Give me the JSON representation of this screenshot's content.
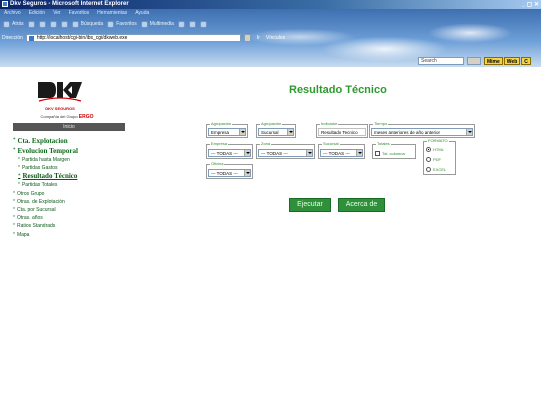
{
  "window": {
    "title": "Dkv Seguros - Microsoft Internet Explorer",
    "controls": "_ ▢ ✕"
  },
  "menu": [
    "Archivo",
    "Edición",
    "Ver",
    "Favoritos",
    "Herramientas",
    "Ayuda"
  ],
  "toolbar": {
    "back": "Atrás",
    "search": "Búsqueda",
    "favorites": "Favoritos",
    "media": "Multimedia"
  },
  "address": {
    "label": "Dirección",
    "url": "http://localhost/cgi-bin/ibs_cgi/dkweb.exe",
    "go": "Ir",
    "links": "Vínculos"
  },
  "search_box": {
    "placeholder": "Search"
  },
  "bookmarks": [
    "Mime",
    "Web",
    "C"
  ],
  "sidebar": {
    "logo_subtitle": "DKV SEGUROS",
    "company_prefix": "Compañía del Grupo",
    "company_brand": "ERGO",
    "inicio": "Inicio",
    "items": [
      {
        "label": "Cta. Explotacion",
        "level": "l1"
      },
      {
        "label": "Evolucion Temporal",
        "level": "l1"
      },
      {
        "label": "Partida hasta Margen",
        "level": "sub"
      },
      {
        "label": "Partidas Gastos",
        "level": "sub"
      },
      {
        "label": "Resultado Técnico",
        "level": "active"
      },
      {
        "label": "Partidas Totales",
        "level": "sub"
      },
      {
        "label": "Otros Grupo",
        "level": "l2"
      },
      {
        "label": "Otras. de Explotación",
        "level": "l2"
      },
      {
        "label": "Cta. por Sucursal",
        "level": "l2"
      },
      {
        "label": "Otras. años",
        "level": "l2"
      },
      {
        "label": "Ratios Standrads",
        "level": "l2"
      },
      {
        "label": "Mapa",
        "level": "l2"
      }
    ]
  },
  "main": {
    "title": "Resultado Técnico",
    "filters": {
      "agrupacion1": {
        "legend": "Agrupación",
        "value": "Empresa"
      },
      "agrupacion2": {
        "legend": "Agrupación",
        "value": "Sucursal"
      },
      "indicador": {
        "legend": "Indicador",
        "value": "Resultado Tecnico"
      },
      "tiempo": {
        "legend": "Tiempo",
        "value": "meses anteriores de año anterior"
      },
      "empresa": {
        "legend": "Empresa",
        "value": "--- TODAS ---"
      },
      "zona": {
        "legend": "Zona",
        "value": "--- TODAS ---"
      },
      "sucursal": {
        "legend": "Sucursal",
        "value": "--- TODAS ---"
      },
      "totales": {
        "legend": "Totales",
        "checkbox_label": "Tot. columna"
      },
      "oficina": {
        "legend": "Oficina",
        "value": "--- TODAS ---"
      },
      "formato": {
        "legend": "FORMATO",
        "options": [
          "HTML",
          "PDF",
          "EXCEL"
        ],
        "selected": "HTML"
      }
    },
    "buttons": {
      "ejecutar": "Ejecutar",
      "acerca": "Acerca de"
    }
  }
}
